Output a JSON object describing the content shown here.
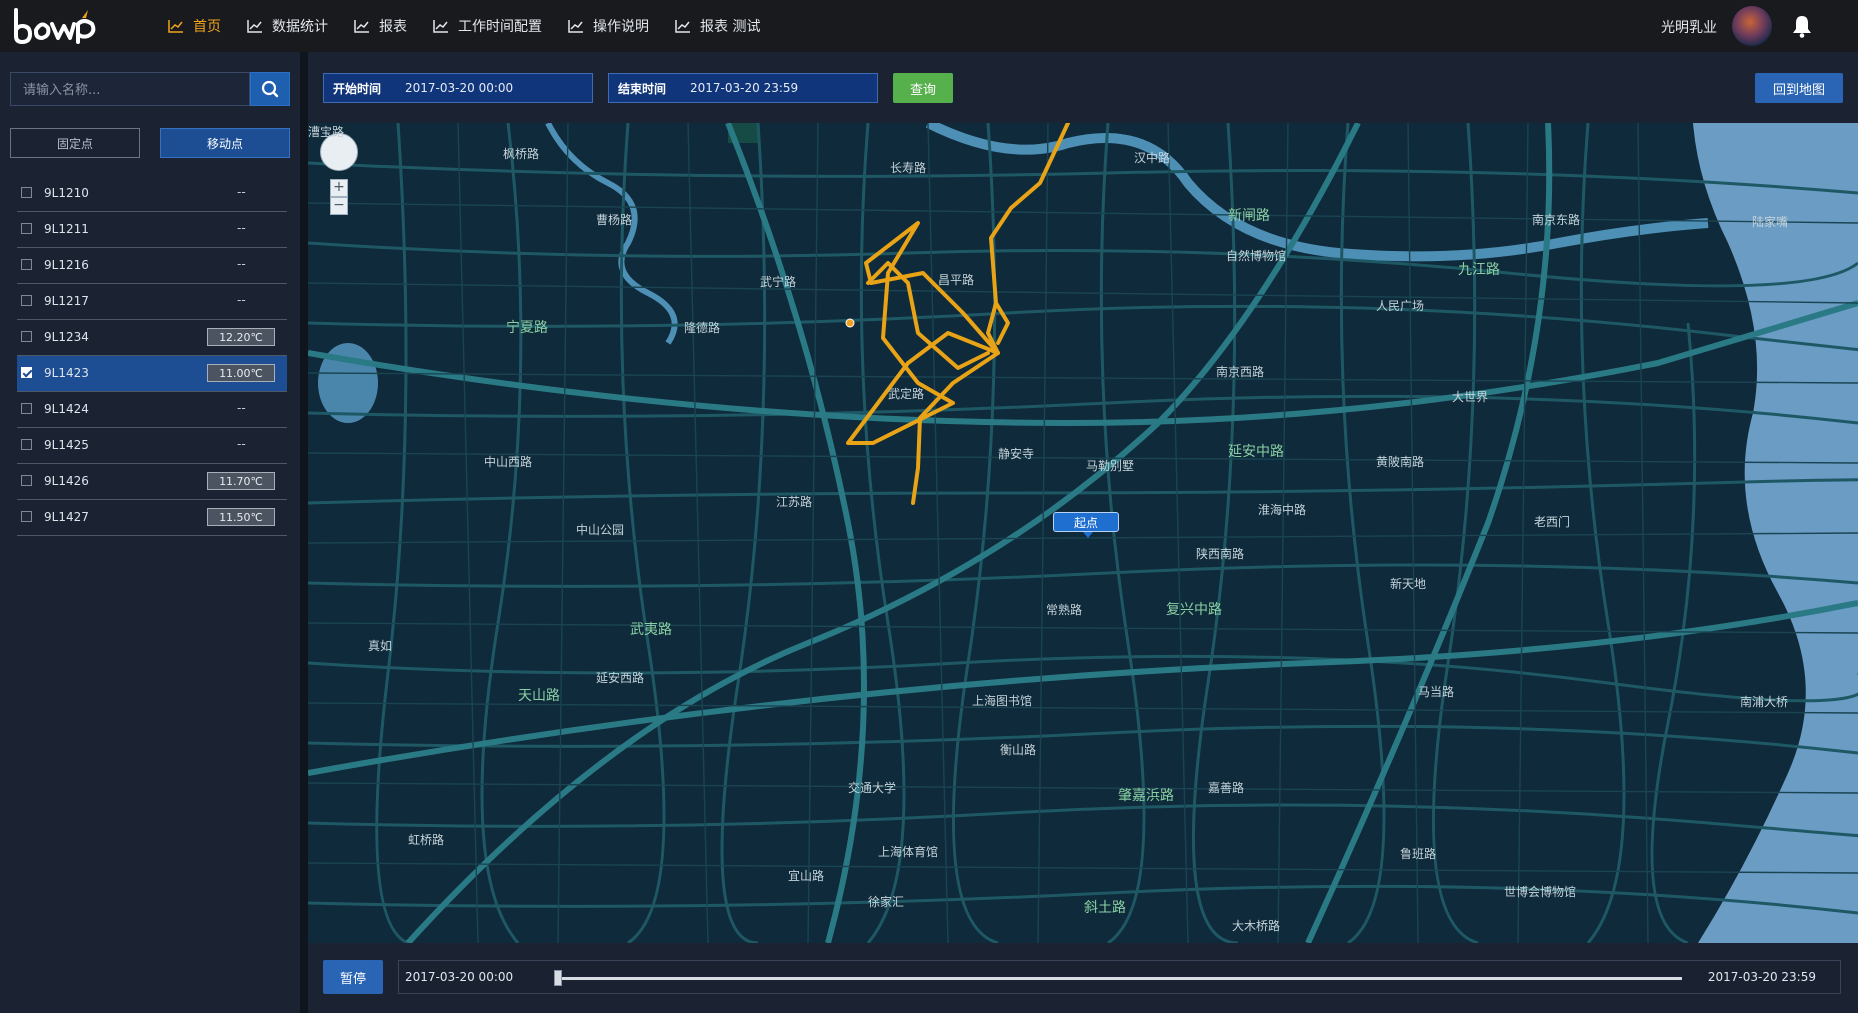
{
  "header": {
    "nav": [
      {
        "label": "首页",
        "active": true
      },
      {
        "label": "数据统计",
        "active": false
      },
      {
        "label": "报表",
        "active": false
      },
      {
        "label": "工作时间配置",
        "active": false
      },
      {
        "label": "操作说明",
        "active": false
      },
      {
        "label": "报表 测试",
        "active": false
      }
    ],
    "user_name": "光明乳业",
    "accent_color": "#f2a31d"
  },
  "sidebar": {
    "search_placeholder": "请输入名称...",
    "tabs": {
      "fixed": "固定点",
      "moving": "移动点"
    },
    "items": [
      {
        "id": "9L1210",
        "value": "--",
        "checked": false
      },
      {
        "id": "9L1211",
        "value": "--",
        "checked": false
      },
      {
        "id": "9L1216",
        "value": "--",
        "checked": false
      },
      {
        "id": "9L1217",
        "value": "--",
        "checked": false
      },
      {
        "id": "9L1234",
        "value": "12.20℃",
        "checked": false
      },
      {
        "id": "9L1423",
        "value": "11.00℃",
        "checked": true
      },
      {
        "id": "9L1424",
        "value": "--",
        "checked": false
      },
      {
        "id": "9L1425",
        "value": "--",
        "checked": false
      },
      {
        "id": "9L1426",
        "value": "11.70℃",
        "checked": false
      },
      {
        "id": "9L1427",
        "value": "11.50℃",
        "checked": false
      }
    ]
  },
  "query": {
    "start_label": "开始时间",
    "start_value": "2017-03-20 00:00",
    "end_label": "结束时间",
    "end_value": "2017-03-20 23:59",
    "query_button": "查询",
    "back_button": "回到地图"
  },
  "map": {
    "start_marker": "起点",
    "route_color": "#e8a317",
    "labels": {
      "l1": "宁夏路",
      "l2": "武宁路",
      "l3": "昌平路",
      "l4": "延安中路",
      "l5": "南京西路",
      "l6": "人民广场",
      "l7": "大世界",
      "l8": "淮海中路",
      "l9": "陕西南路",
      "l10": "新天地",
      "l11": "常熟路",
      "l12": "上海图书馆",
      "l13": "衡山路",
      "l14": "交通大学",
      "l15": "徐家汇",
      "l16": "江苏路",
      "l17": "中山公园",
      "l18": "延安西路",
      "l19": "武夷路",
      "l20": "天山路",
      "l21": "复兴中路",
      "l22": "肇嘉浜路",
      "l23": "斜土路",
      "l24": "九江路",
      "l25": "新闸路",
      "l26": "自然博物馆",
      "l27": "静安寺",
      "l28": "马勒别墅",
      "l29": "隆德路",
      "l30": "曹杨路",
      "l31": "长寿路",
      "l32": "汉中路",
      "l33": "南京东路",
      "l34": "陆家嘴",
      "l35": "老西门",
      "l36": "马当路",
      "l37": "嘉善路",
      "l38": "鲁班路",
      "l39": "大木桥路",
      "l40": "世博会博物馆",
      "l41": "南浦大桥",
      "l42": "枫桥路",
      "l43": "真如",
      "l44": "武定路",
      "l45": "虹桥路",
      "l46": "宜山路",
      "l47": "漕宝路",
      "l48": "上海体育馆",
      "l49": "中山西路",
      "l50": "黄陂南路"
    }
  },
  "timeline": {
    "play_button": "暂停",
    "start": "2017-03-20 00:00",
    "end": "2017-03-20 23:59",
    "progress": 0
  }
}
